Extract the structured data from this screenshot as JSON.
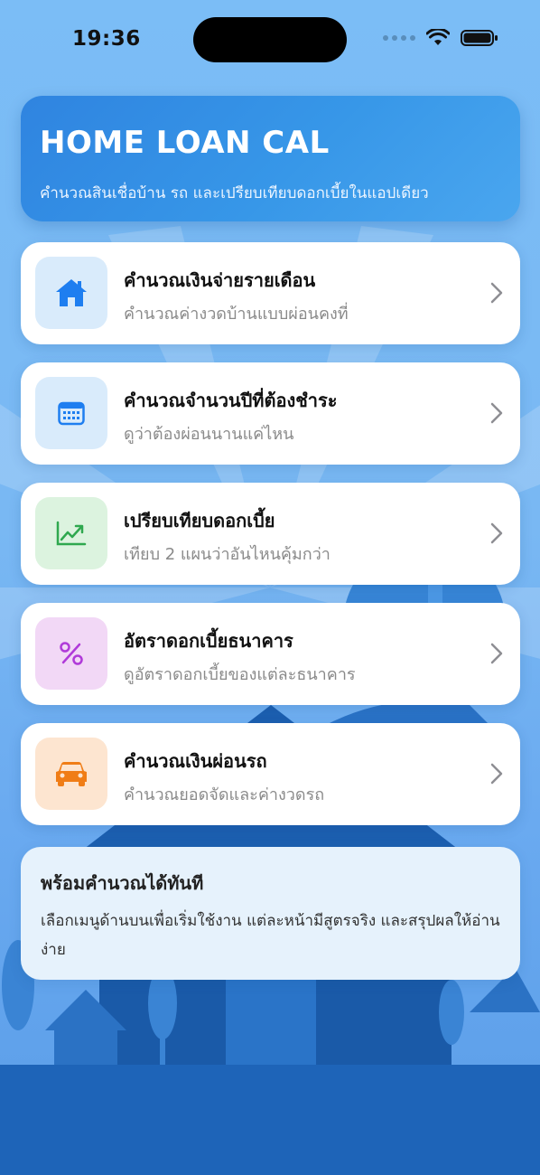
{
  "status_bar": {
    "time": "19:36"
  },
  "header": {
    "title": "HOME LOAN CAL",
    "subtitle": "คำนวณสินเชื่อบ้าน รถ และเปรียบเทียบดอกเบี้ยในแอปเดียว"
  },
  "menu": [
    {
      "title": "คำนวณเงินจ่ายรายเดือน",
      "subtitle": "คำนวณค่างวดบ้านแบบผ่อนคงที่",
      "icon": "house-icon",
      "icon_color": "#1e7ef0",
      "icon_bg": "#d9ebfb"
    },
    {
      "title": "คำนวณจำนวนปีที่ต้องชำระ",
      "subtitle": "ดูว่าต้องผ่อนนานแค่ไหน",
      "icon": "calendar-icon",
      "icon_color": "#1e7ef0",
      "icon_bg": "#d9ebfb"
    },
    {
      "title": "เปรียบเทียบดอกเบี้ย",
      "subtitle": "เทียบ 2 แผนว่าอันไหนคุ้มกว่า",
      "icon": "trending-up-icon",
      "icon_color": "#2fa84f",
      "icon_bg": "#dcf3df"
    },
    {
      "title": "อัตราดอกเบี้ยธนาคาร",
      "subtitle": "ดูอัตราดอกเบี้ยของแต่ละธนาคาร",
      "icon": "percent-icon",
      "icon_color": "#b03ad9",
      "icon_bg": "#f2d8f6"
    },
    {
      "title": "คำนวณเงินผ่อนรถ",
      "subtitle": "คำนวณยอดจัดและค่างวดรถ",
      "icon": "car-icon",
      "icon_color": "#f07d16",
      "icon_bg": "#fde5d0"
    }
  ],
  "info": {
    "title": "พร้อมคำนวณได้ทันที",
    "text": "เลือกเมนูด้านบนเพื่อเริ่มใช้งาน แต่ละหน้ามีสูตรจริง และสรุปผลให้อ่านง่าย"
  }
}
